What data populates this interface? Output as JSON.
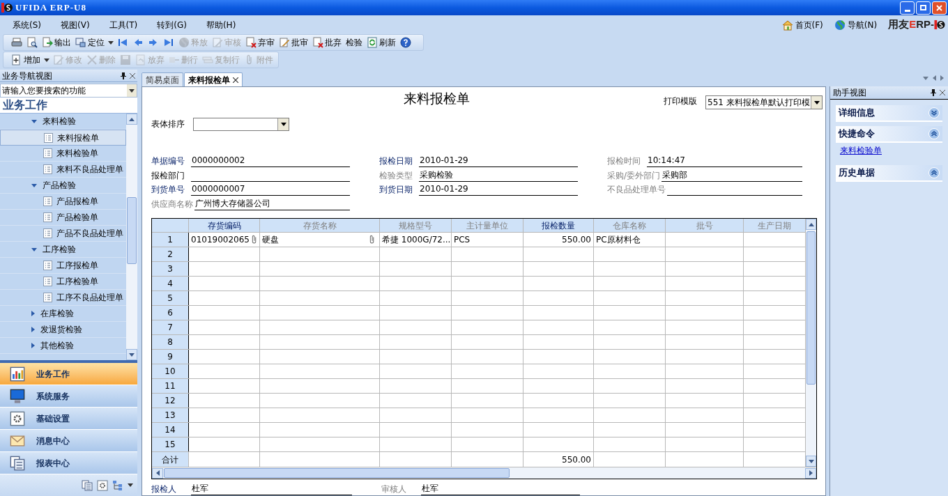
{
  "window": {
    "title": "UFIDA ERP-U8"
  },
  "menu": [
    {
      "label": "系统(S)"
    },
    {
      "label": "视图(V)"
    },
    {
      "label": "工具(T)"
    },
    {
      "label": "转到(G)"
    },
    {
      "label": "帮助(H)"
    }
  ],
  "top_links": [
    {
      "label": "首页(F)"
    },
    {
      "label": "导航(N)"
    }
  ],
  "brand": [
    {
      "text": "用友",
      "color": "#222222"
    },
    {
      "text": "E",
      "color": "#e0301e"
    },
    {
      "text": "RP-",
      "color": "#222222"
    }
  ],
  "toolbar_1": [
    {
      "disabled": false
    },
    {
      "disabled": false
    },
    {
      "label": "输出",
      "disabled": false
    },
    {
      "label": "定位",
      "disabled": false,
      "dropdown": true
    },
    {
      "disabled": false
    },
    {
      "disabled": false
    },
    {
      "disabled": false
    },
    {
      "disabled": false
    },
    {
      "label": "释放",
      "disabled": true
    },
    {
      "label": "审核",
      "disabled": true
    },
    {
      "label": "弃审",
      "disabled": false
    },
    {
      "label": "批审",
      "disabled": false
    },
    {
      "label": "批弃",
      "disabled": false
    },
    {
      "label": "检验",
      "disabled": false
    },
    {
      "label": "刷新",
      "disabled": false
    },
    {
      "disabled": false
    }
  ],
  "toolbar_2": [
    {
      "label": "增加",
      "disabled": false,
      "dropdown": true
    },
    {
      "label": "修改",
      "disabled": true
    },
    {
      "label": "删除",
      "disabled": true
    },
    {
      "disabled": true
    },
    {
      "label": "放弃",
      "disabled": true
    },
    {
      "label": "删行",
      "disabled": true
    },
    {
      "label": "复制行",
      "disabled": true
    },
    {
      "label": "附件",
      "disabled": true
    }
  ],
  "nav_panel": {
    "title": "业务导航视图",
    "search": {
      "placeholder": "请输入您要搜索的功能"
    },
    "heading": "业务工作",
    "tree": [
      {
        "label": "来料检验",
        "expanded": true,
        "children": [
          {
            "label": "来料报检单",
            "selected": true
          },
          {
            "label": "来料检验单",
            "selected": false
          },
          {
            "label": "来料不良品处理单",
            "selected": false
          }
        ]
      },
      {
        "label": "产品检验",
        "expanded": true,
        "children": [
          {
            "label": "产品报检单",
            "selected": false
          },
          {
            "label": "产品检验单",
            "selected": false
          },
          {
            "label": "产品不良品处理单",
            "selected": false
          }
        ]
      },
      {
        "label": "工序检验",
        "expanded": true,
        "children": [
          {
            "label": "工序报检单",
            "selected": false
          },
          {
            "label": "工序检验单",
            "selected": false
          },
          {
            "label": "工序不良品处理单",
            "selected": false
          }
        ]
      },
      {
        "label": "在库检验",
        "expanded": false
      },
      {
        "label": "发退货检验",
        "expanded": false
      },
      {
        "label": "其他检验",
        "expanded": false
      }
    ],
    "modules": [
      {
        "label": "业务工作",
        "selected": true
      },
      {
        "label": "系统服务",
        "selected": false
      },
      {
        "label": "基础设置",
        "selected": false
      },
      {
        "label": "消息中心",
        "selected": false
      },
      {
        "label": "报表中心",
        "selected": false
      }
    ]
  },
  "tabs": [
    {
      "label": "简易桌面",
      "selected": false
    },
    {
      "label": "来料报检单",
      "selected": true
    }
  ],
  "form": {
    "title": "来料报检单",
    "sort": {
      "label": "表体排序"
    },
    "print_template": {
      "label": "打印模版",
      "value": "551 来料报检单默认打印模"
    },
    "header_rows": [
      [
        {
          "label": "单据编号",
          "value": "0000000002",
          "kind": "required"
        },
        {
          "label": "报检日期",
          "value": "2010-01-29",
          "kind": "required"
        },
        {
          "label": "报检时间",
          "value": "10:14:47",
          "kind": "disabled"
        }
      ],
      [
        {
          "label": "报检部门",
          "kind": "normal"
        },
        {
          "label": "检验类型",
          "value": "采购检验",
          "kind": "disabled"
        },
        {
          "label": "采购/委外部门",
          "value": "采购部",
          "kind": "disabled"
        }
      ],
      [
        {
          "label": "到货单号",
          "value": "0000000007",
          "kind": "required"
        },
        {
          "label": "到货日期",
          "value": "2010-01-29",
          "kind": "required"
        },
        {
          "label": "不良品处理单号",
          "kind": "disabled"
        }
      ],
      [
        {
          "label": "供应商名称",
          "value": "广州博大存储器公司",
          "kind": "disabled"
        }
      ]
    ],
    "table": {
      "columns": [
        {
          "label": "存货编码",
          "kind": "required"
        },
        {
          "label": "存货名称",
          "kind": "disabled"
        },
        {
          "label": "规格型号",
          "kind": "disabled"
        },
        {
          "label": "主计量单位",
          "kind": "disabled"
        },
        {
          "label": "报检数量",
          "kind": "required",
          "numeric": true
        },
        {
          "label": "仓库名称",
          "kind": "disabled"
        },
        {
          "label": "批号",
          "kind": "disabled"
        },
        {
          "label": "生产日期",
          "kind": "disabled"
        }
      ],
      "rows": [
        {
          "no": "1",
          "cells": [
            {
              "text": "01019002065",
              "attachment": true
            },
            {
              "text": "硬盘",
              "attachment": true
            },
            {
              "text": "希捷 1000G/72..."
            },
            {
              "text": "PCS"
            },
            {
              "text": "550.00"
            },
            {
              "text": "PC原材料仓"
            }
          ]
        },
        {
          "no": "2"
        },
        {
          "no": "3"
        },
        {
          "no": "4"
        },
        {
          "no": "5"
        },
        {
          "no": "6"
        },
        {
          "no": "7"
        },
        {
          "no": "8"
        },
        {
          "no": "9"
        },
        {
          "no": "10"
        },
        {
          "no": "11"
        },
        {
          "no": "12"
        },
        {
          "no": "13"
        },
        {
          "no": "14"
        },
        {
          "no": "15"
        }
      ],
      "total": {
        "label": "合计",
        "quantity": "550.00"
      }
    },
    "footer": [
      {
        "label": "报检人",
        "value": "杜军",
        "kind": "required"
      },
      {
        "label": "审核人",
        "value": "杜军",
        "kind": "disabled"
      }
    ]
  },
  "helper_panel": {
    "title": "助手视图",
    "sections": [
      {
        "title": "详细信息",
        "expanded": false
      },
      {
        "title": "快捷命令",
        "expanded": true,
        "links": [
          "来料检验单"
        ]
      },
      {
        "title": "历史单据",
        "expanded": true
      }
    ]
  }
}
